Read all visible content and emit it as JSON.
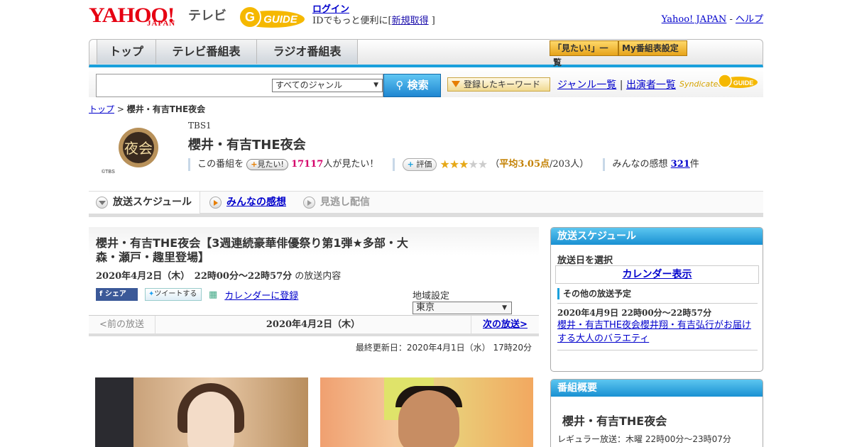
{
  "header": {
    "logo_text": "YAHOO!",
    "logo_sub": "JAPAN",
    "tv_label": "テレビ",
    "gguide_label": "GUIDE",
    "login_label": "ログイン",
    "login_prompt": "IDでもっと便利に[",
    "signup_label": "新規取得",
    "bracket_close": "]",
    "yahoo_japan_link": "Yahoo! JAPAN",
    "separator": "-",
    "help_link": "ヘルプ"
  },
  "nav": {
    "tabs": [
      {
        "label": "トップ"
      },
      {
        "label": "テレビ番組表"
      },
      {
        "label": "ラジオ番組表"
      }
    ],
    "want_list_label": "「見たい!」一覧",
    "my_schedule_label": "My番組表設定"
  },
  "search": {
    "input_value": "",
    "genre_selected": "すべてのジャンル",
    "search_button": "検索",
    "keyword_button": "登録したキーワード",
    "genre_list_link": "ジャンル一覧",
    "divider": "|",
    "cast_list_link": "出演者一覧",
    "syndicated": "Syndicated",
    "gguide_label": "GUIDE"
  },
  "breadcrumb": {
    "home": "トップ",
    "sep": ">",
    "current": "櫻井・有吉THE夜会"
  },
  "program": {
    "logo_text": "夜会",
    "logo_copy": "©TBS",
    "channel": "TBS1",
    "title": "櫻井・有吉THE夜会",
    "want_prefix": "この番組を",
    "want_button": "見たい!",
    "want_count": "17117",
    "want_suffix": "人が見たい！",
    "rating_button": "評価",
    "rating_value": 3.05,
    "rating_open": "（",
    "rating_avg": "平均3.05点",
    "rating_count": "/203人）",
    "impressions_label": "みんなの感想",
    "impressions_count": "321",
    "impressions_unit": "件"
  },
  "tabs": [
    {
      "label": "放送スケジュール",
      "active": true
    },
    {
      "label": "みんなの感想",
      "active": false
    },
    {
      "label": "見逃し配信",
      "active": false
    }
  ],
  "episode": {
    "title": "櫻井・有吉THE夜会【3週連続豪華俳優祭り第1弾★多部・大森・瀬戸・趣里登場】",
    "datetime": "2020年4月2日（木）　22時00分～22時57分",
    "datetime_suffix": "の放送内容",
    "fb_share": "シェア",
    "tweet": "ツイートする",
    "calendar_register": "カレンダーに登録",
    "region_label": "地域設定",
    "region_value": "東京"
  },
  "pager": {
    "prev": "<前の放送",
    "current": "2020年4月2日（木）",
    "next": "次の放送>"
  },
  "updated": "最終更新日：2020年4月1日（水） 17時20分",
  "sidebar": {
    "schedule_title": "放送スケジュール",
    "select_date": "放送日を選択",
    "calendar_link": "カレンダー表示",
    "other_title": "その他の放送予定",
    "other_date": "2020年4月9日 22時00分～22時57分",
    "other_link": "櫻井・有吉THE夜会櫻井翔・有吉弘行がお届けする大人のバラエティ",
    "overview_title": "番組概要",
    "overview_name": "櫻井・有吉THE夜会",
    "overview_regular": "レギュラー放送：木曜 22時00分～23時07分"
  },
  "colors": {
    "accent_blue": "#1aa0dc",
    "yahoo_red": "#e60012",
    "gguide_yellow": "#f5b800",
    "link": "#0000cc",
    "want_count": "#d4006a"
  }
}
